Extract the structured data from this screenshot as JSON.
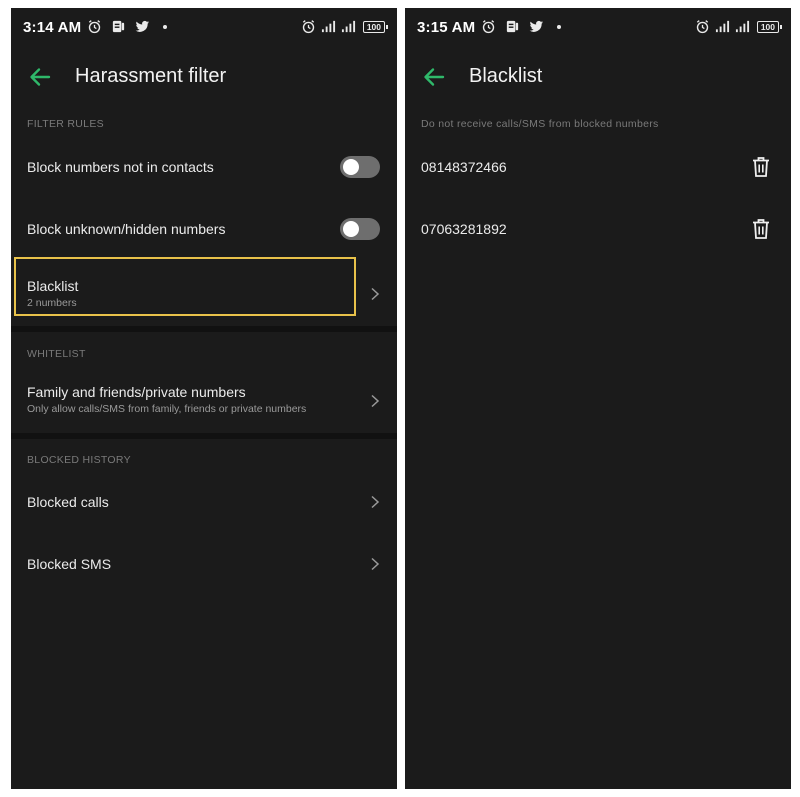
{
  "left_screen": {
    "status_bar": {
      "time": "3:14 AM",
      "battery": "100"
    },
    "header": {
      "title": "Harassment filter"
    },
    "filter_rules": {
      "label": "FILTER RULES",
      "items": [
        {
          "title": "Block numbers not in contacts",
          "toggle": "off"
        },
        {
          "title": "Block unknown/hidden numbers",
          "toggle": "off"
        }
      ],
      "blacklist": {
        "title": "Blacklist",
        "subtitle": "2 numbers"
      }
    },
    "whitelist": {
      "label": "WHITELIST",
      "item": {
        "title": "Family and friends/private numbers",
        "subtitle": "Only allow calls/SMS from family, friends or private numbers"
      }
    },
    "blocked_history": {
      "label": "BLOCKED HISTORY",
      "items": [
        {
          "title": "Blocked calls"
        },
        {
          "title": "Blocked SMS"
        }
      ]
    }
  },
  "right_screen": {
    "status_bar": {
      "time": "3:15 AM",
      "battery": "100"
    },
    "header": {
      "title": "Blacklist"
    },
    "description": "Do not receive calls/SMS from blocked numbers",
    "numbers": [
      "08148372466",
      "07063281892"
    ]
  },
  "colors": {
    "background": "#1b1b1b",
    "accent_green": "#2fb86a",
    "highlight": "#e8c24a",
    "toggle_off": "#6e6e6e"
  },
  "icons": {
    "status_left": [
      "alarm-icon",
      "app-icon",
      "twitter-icon",
      "dot-icon"
    ],
    "status_right": [
      "alarm-icon",
      "signal-icon",
      "signal-icon",
      "battery-icon"
    ],
    "header": "back-arrow-icon",
    "row_action": "chevron-right-icon",
    "delete": "trash-icon"
  }
}
